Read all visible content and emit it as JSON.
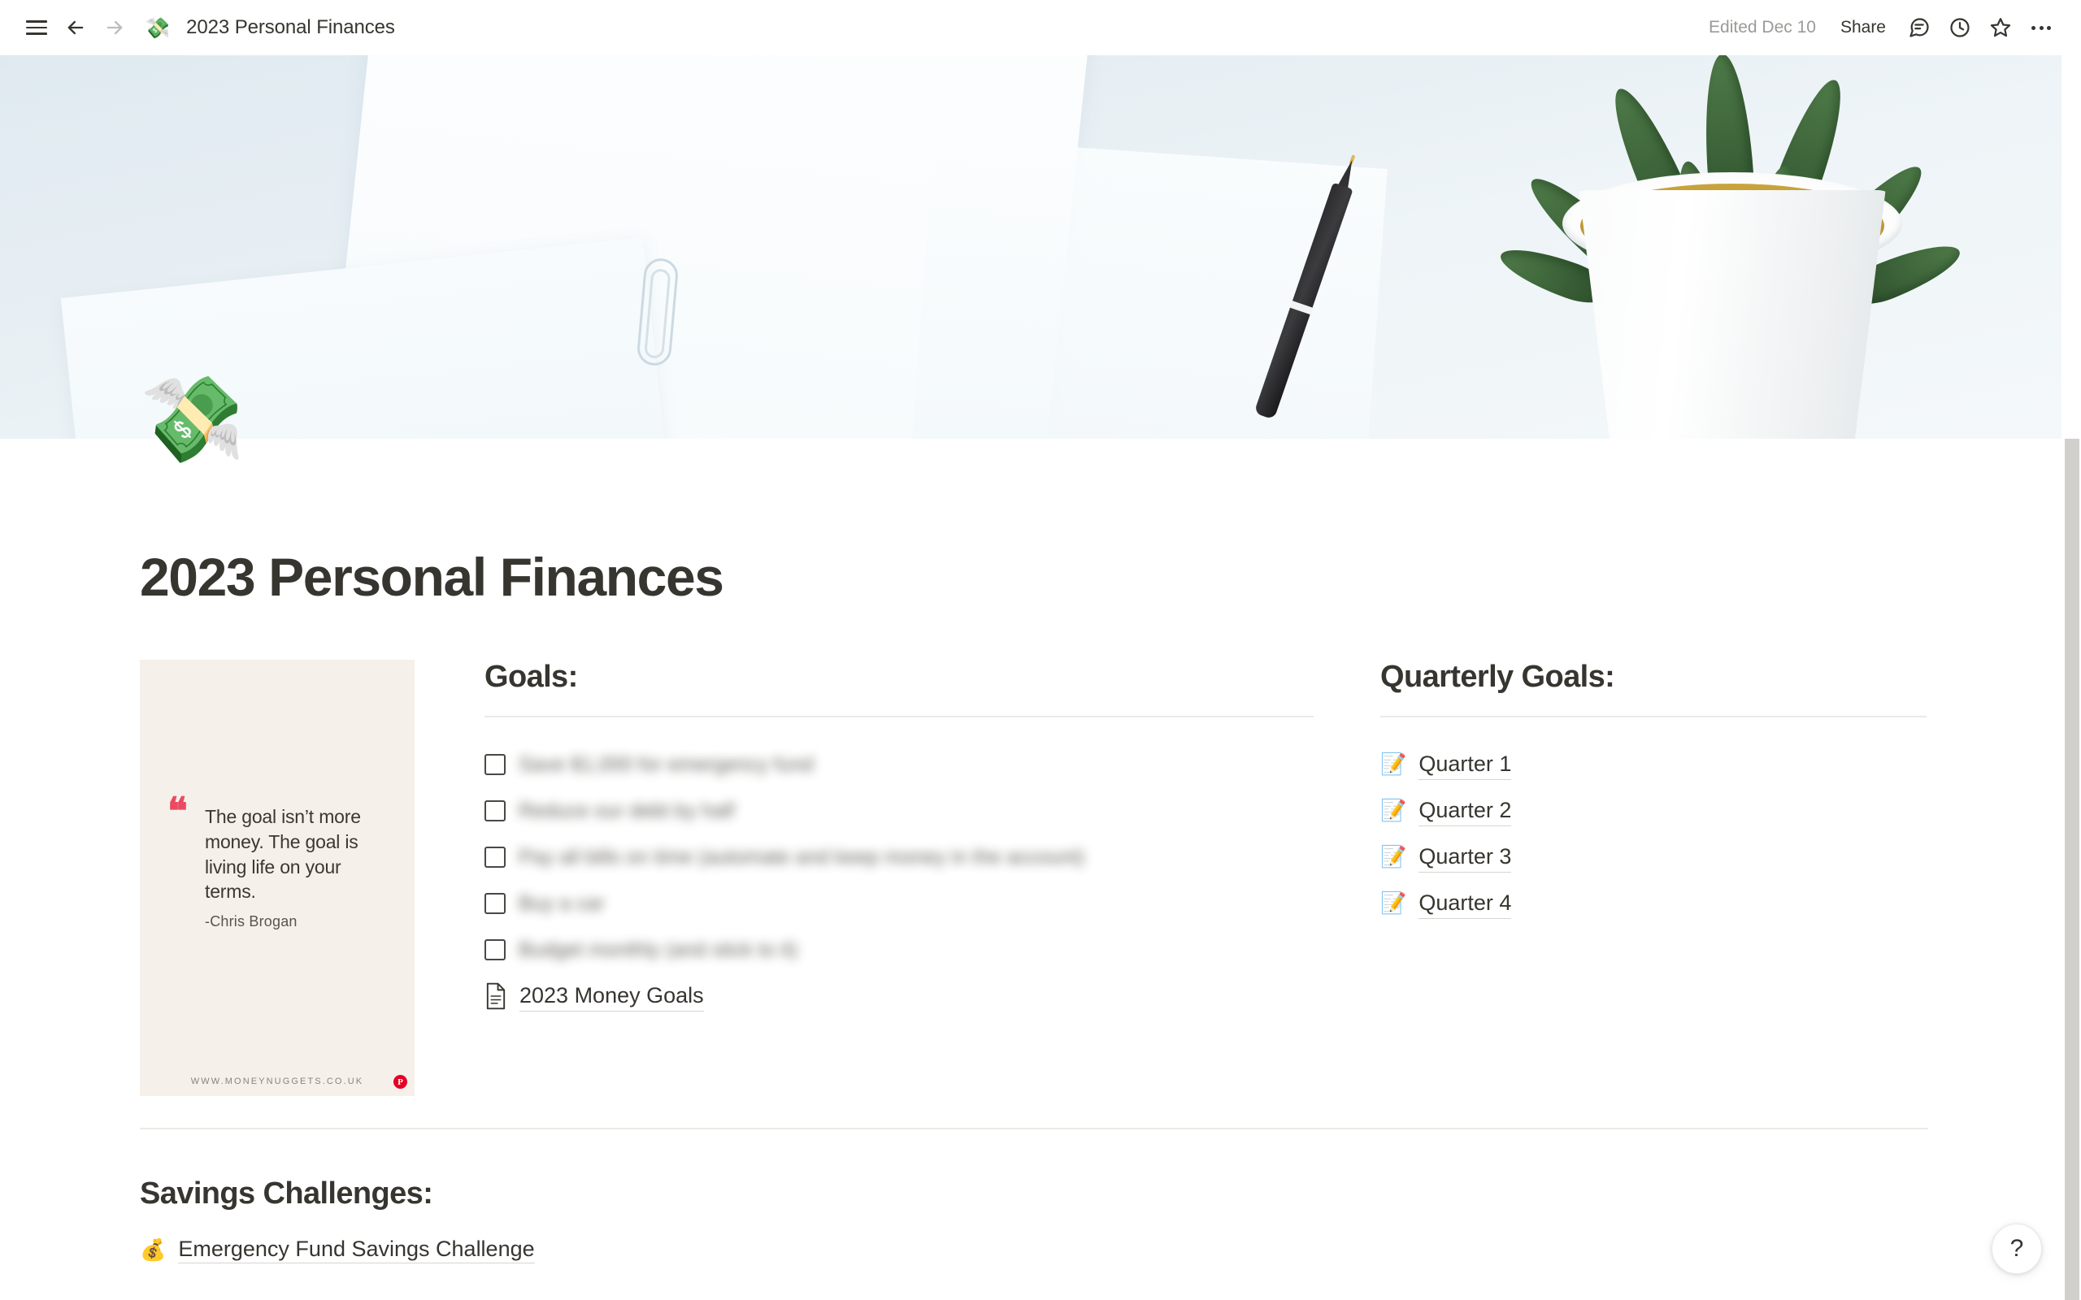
{
  "topbar": {
    "menu_icon": "hamburger-icon",
    "back_icon": "arrow-left-icon",
    "forward_icon": "arrow-right-icon",
    "page_emoji": "💸",
    "breadcrumb_title": "2023 Personal Finances",
    "edited_label": "Edited Dec 10",
    "share_label": "Share",
    "comment_icon": "comment-icon",
    "history_icon": "clock-history-icon",
    "favorite_icon": "star-icon",
    "more_icon": "more-options-icon"
  },
  "page": {
    "icon_emoji": "💸",
    "title": "2023 Personal Finances"
  },
  "quote_card": {
    "quote_mark": "“",
    "text": "The goal isn’t more money. The goal is living life on your terms.",
    "author": "-Chris Brogan",
    "source": "WWW.MONEYNUGGETS.CO.UK",
    "badge": "P",
    "bg_color": "#f6f0ea",
    "accent_color": "#ea4a62"
  },
  "goals": {
    "heading": "Goals:",
    "items": [
      {
        "label": "Save $1,000 for emergency fund",
        "checked": false
      },
      {
        "label": "Reduce our debt by half",
        "checked": false
      },
      {
        "label": "Pay all bills on time (automate and keep money in the account)",
        "checked": false
      },
      {
        "label": "Buy a car",
        "checked": false
      },
      {
        "label": "Budget monthly (and stick to it)",
        "checked": false
      }
    ],
    "page_link": {
      "icon": "page-document-icon",
      "label": "2023 Money Goals"
    }
  },
  "quarterly": {
    "heading": "Quarterly Goals:",
    "items": [
      {
        "emoji": "📝",
        "label": "Quarter 1"
      },
      {
        "emoji": "📝",
        "label": "Quarter 2"
      },
      {
        "emoji": "📝",
        "label": "Quarter 3"
      },
      {
        "emoji": "📝",
        "label": "Quarter 4"
      }
    ]
  },
  "savings": {
    "heading": "Savings Challenges:",
    "items": [
      {
        "emoji": "💰",
        "label": "Emergency Fund Savings Challenge"
      }
    ]
  },
  "help": {
    "label": "?"
  }
}
